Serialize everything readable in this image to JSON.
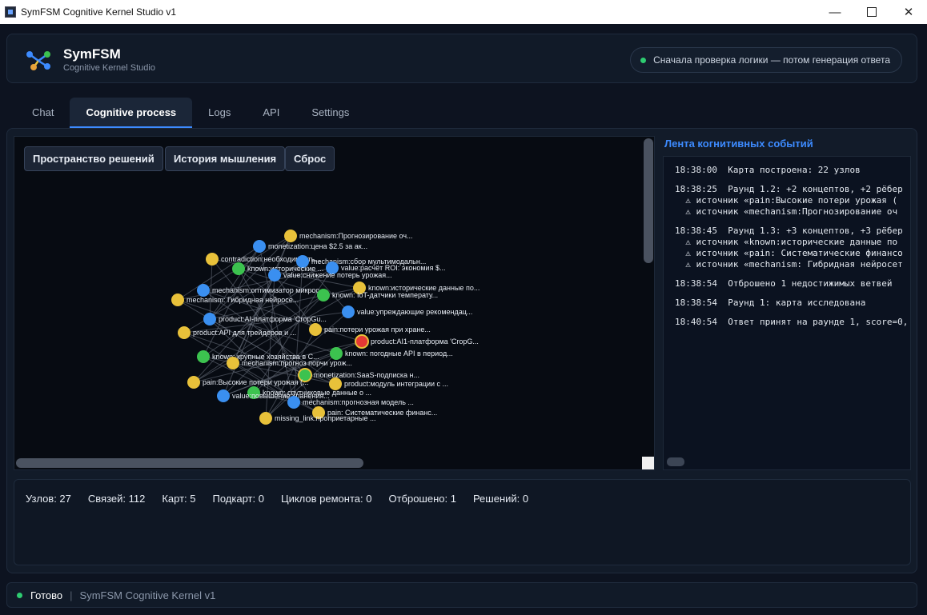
{
  "window": {
    "title": "SymFSM Cognitive Kernel Studio v1",
    "minimize": "—",
    "close": "✕"
  },
  "header": {
    "brand": "SymFSM",
    "subtitle": "Cognitive Kernel Studio",
    "status": "Сначала проверка логики — потом генерация ответа"
  },
  "tabs": [
    {
      "label": "Chat",
      "active": false
    },
    {
      "label": "Cognitive process",
      "active": true
    },
    {
      "label": "Logs",
      "active": false
    },
    {
      "label": "API",
      "active": false
    },
    {
      "label": "Settings",
      "active": false
    }
  ],
  "graph_panel": {
    "buttons": {
      "solution_space": "Пространство решений",
      "thinking_history": "История мышления",
      "reset": "Сброс"
    },
    "node_colors": {
      "yellow": "#e8c13a",
      "blue": "#3a8ff0",
      "green": "#3cc24f",
      "red": "#e53935"
    },
    "nodes": [
      {
        "label": "mechanism:Прогнозирование оч...",
        "color": "yellow"
      },
      {
        "label": "monetization:цена $2.5 за ак...",
        "color": "blue"
      },
      {
        "label": "contradiction:необходимость...",
        "color": "yellow"
      },
      {
        "label": "mechanism:сбор мультимодальн...",
        "color": "blue"
      },
      {
        "label": "known:исторические ...",
        "color": "green"
      },
      {
        "label": "value:расчёт ROI: экономия $...",
        "color": "blue"
      },
      {
        "label": "value:снижение потерь урожая...",
        "color": "blue"
      },
      {
        "label": "mechanism:оптимизатор микрос...",
        "color": "blue"
      },
      {
        "label": "known:исторические данные по...",
        "color": "yellow"
      },
      {
        "label": "mechanism: Гибридная нейросе...",
        "color": "yellow"
      },
      {
        "label": "known: IoT-датчики температу...",
        "color": "green"
      },
      {
        "label": "value:упреждающие рекомендац...",
        "color": "blue"
      },
      {
        "label": "product:AI-платформа 'CropGu...",
        "color": "blue"
      },
      {
        "label": "product:API для трейдеров и ...",
        "color": "yellow"
      },
      {
        "label": "pain:потери урожая при хране...",
        "color": "yellow"
      },
      {
        "label": "product:AI1-платформа 'CropG...",
        "color": "red"
      },
      {
        "label": "known: крупные хозяйства в С...",
        "color": "green"
      },
      {
        "label": "known: погодные API в период...",
        "color": "green"
      },
      {
        "label": "mechanism:прогноз порчи урож...",
        "color": "yellow"
      },
      {
        "label": "monetization:SaaS-подписка н...",
        "color": "green-ring"
      },
      {
        "label": "pain:Высокие потери урожая (...",
        "color": "yellow"
      },
      {
        "label": "product:модуль интеграции с ...",
        "color": "yellow"
      },
      {
        "label": "known: спутниковые данные о ...",
        "color": "green"
      },
      {
        "label": "value:повышение хранения...",
        "color": "blue"
      },
      {
        "label": "mechanism:прогнозная модель ...",
        "color": "blue"
      },
      {
        "label": "pain: Систематические финанс...",
        "color": "yellow"
      },
      {
        "label": "missing_link:проприетарные ...",
        "color": "yellow"
      }
    ]
  },
  "feed": {
    "title": "Лента когнитивных событий",
    "entries": [
      {
        "lines": [
          "18:38:00  Карта построена: 22 узлов"
        ]
      },
      {
        "lines": [
          "18:38:25  Раунд 1.2: +2 концептов, +2 рёбер",
          "  ⚠ источник «pain:Высокие потери урожая (",
          "  ⚠ источник «mechanism:Прогнозирование оч"
        ]
      },
      {
        "lines": [
          "18:38:45  Раунд 1.3: +3 концептов, +3 рёбер",
          "  ⚠ источник «known:исторические данные по",
          "  ⚠ источник «pain: Систематические финансо",
          "  ⚠ источник «mechanism: Гибридная нейросет"
        ]
      },
      {
        "lines": [
          "18:38:54  Отброшено 1 недостижимых ветвей"
        ]
      },
      {
        "lines": [
          "18:38:54  Раунд 1: карта исследована"
        ]
      },
      {
        "lines": [
          "18:40:54  Ответ принят на раунде 1, score=0,"
        ]
      }
    ]
  },
  "stats": {
    "nodes": "Узлов: 27",
    "edges": "Связей: 112",
    "maps": "Карт: 5",
    "submaps": "Подкарт: 0",
    "repair_cycles": "Циклов ремонта: 0",
    "discarded": "Отброшено: 1",
    "solutions": "Решений: 0"
  },
  "footer": {
    "ready": "Готово",
    "separator": "|",
    "kernel": "SymFSM Cognitive Kernel v1"
  }
}
